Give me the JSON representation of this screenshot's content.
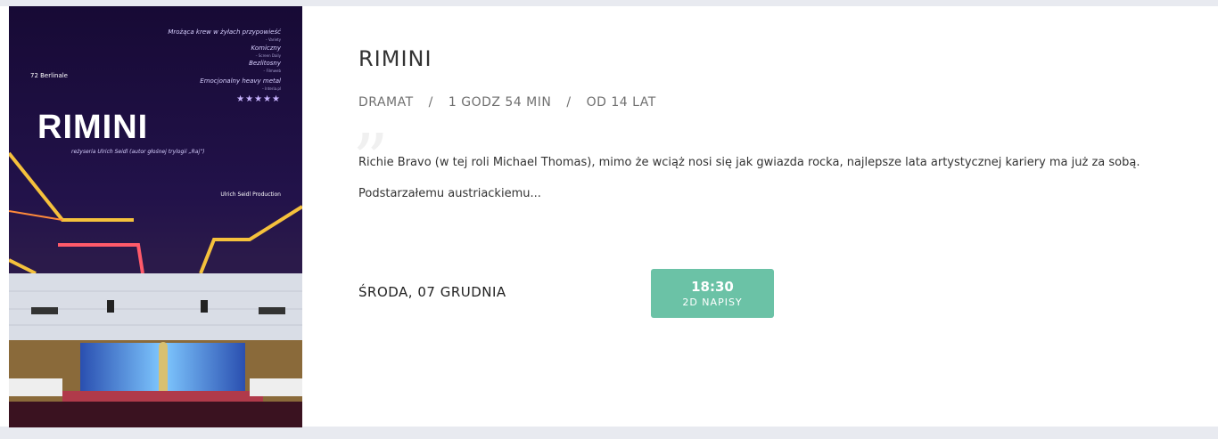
{
  "poster": {
    "title": "RIMINI",
    "credit": "reżyseria Ulrich Seidl (autor głośnej trylogii „Raj”)",
    "quotes": [
      {
        "text": "Mrożąca krew w żyłach przypowieść",
        "source": "– Variety"
      },
      {
        "text": "Komiczny",
        "source": "– Screen Daily"
      },
      {
        "text": "Bezlitosny",
        "source": "– Filmweb"
      },
      {
        "text": "Emocjonalny heavy metal",
        "source": "– Interia.pl"
      }
    ],
    "stars": "★★★★★",
    "festival": "72 Berlinale",
    "production": "Ulrich Seidl Production"
  },
  "movie": {
    "title": "RIMINI",
    "genre": "DRAMAT",
    "duration": "1 GODZ 54 MIN",
    "age": "OD 14 LAT",
    "separator": "/",
    "quote_mark": "”",
    "description": "Richie Bravo (w tej roli Michael Thomas), mimo że wciąż nosi się jak gwiazda rocka, najlepsze lata artystycznej kariery ma już za sobą. Podstarzałemu austriackiemu..."
  },
  "schedule": {
    "date": "ŚRODA, 07 GRUDNIA",
    "showtimes": [
      {
        "time": "18:30",
        "type": "2D NAPISY"
      }
    ]
  },
  "colors": {
    "button": "#6bc2a6",
    "poster_bg": "#1b0f3a",
    "page_bg": "#e8eaf0"
  }
}
